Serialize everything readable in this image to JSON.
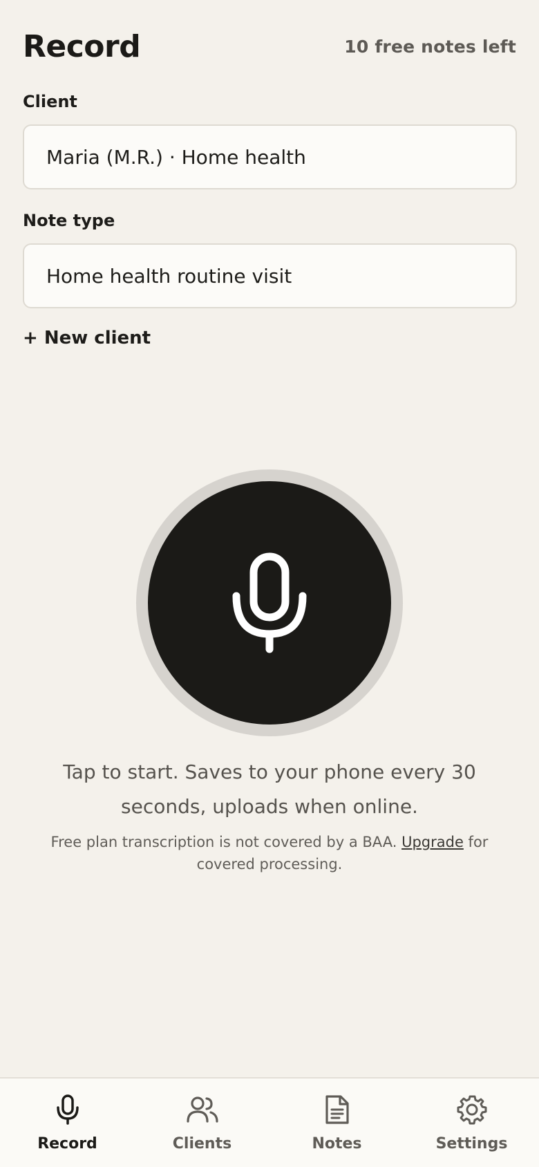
{
  "header": {
    "title": "Record",
    "notes_left": "10 free notes left"
  },
  "form": {
    "client_label": "Client",
    "client_value": "Maria (M.R.) · Home health",
    "note_type_label": "Note type",
    "note_type_value": "Home health routine visit",
    "new_client_label": "+ New client"
  },
  "recorder": {
    "icon": "microphone-icon",
    "hint": "Tap to start. Saves to your phone every 30 seconds, uploads when online.",
    "disclaimer_before": "Free plan transcription is not covered by a BAA. ",
    "disclaimer_link": "Upgrade",
    "disclaimer_after": " for covered processing."
  },
  "tabs": [
    {
      "label": "Record",
      "icon": "microphone-icon",
      "active": true
    },
    {
      "label": "Clients",
      "icon": "users-icon",
      "active": false
    },
    {
      "label": "Notes",
      "icon": "document-icon",
      "active": false
    },
    {
      "label": "Settings",
      "icon": "gear-icon",
      "active": false
    }
  ],
  "colors": {
    "background": "#f4f1eb",
    "record_button": "#1b1a17",
    "record_ring": "#d6d3ce",
    "active_tab": "#1b1a17",
    "inactive_tab": "#5f5c57"
  }
}
